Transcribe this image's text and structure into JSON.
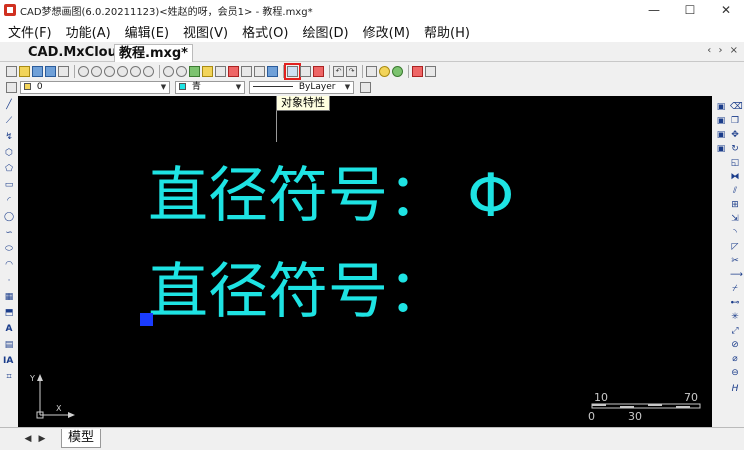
{
  "window": {
    "title": "CAD梦想画图(6.0.20211123)<姓赵的呀，会员1> - 教程.mxg*",
    "minimize_label": "—",
    "maximize_label": "☐",
    "close_label": "✕"
  },
  "menu": {
    "items": [
      {
        "label": "文件(F)"
      },
      {
        "label": "功能(A)"
      },
      {
        "label": "编辑(E)"
      },
      {
        "label": "视图(V)"
      },
      {
        "label": "格式(O)"
      },
      {
        "label": "绘图(D)"
      },
      {
        "label": "修改(M)"
      },
      {
        "label": "帮助(H)"
      }
    ]
  },
  "tabs": {
    "items": [
      {
        "label": "CAD.MxCloud"
      },
      {
        "label": "教程.mxg*"
      }
    ],
    "arrows": "‹ › ×"
  },
  "layer_bar": {
    "layer_value": "0",
    "color_value": "青",
    "linetype_value": "ByLayer"
  },
  "tooltip": {
    "text": "对象特性"
  },
  "canvas": {
    "background": "#000000",
    "text_color": "#1ee3e3",
    "text_line1": "直径符号：  Φ",
    "text_line2": "直径符号：",
    "ucs_y": "Y",
    "ucs_x": "X",
    "scale_labels": {
      "a": "10",
      "b": "70",
      "c": "0",
      "d": "30"
    }
  },
  "layout_tabs": {
    "model_label": "模型"
  },
  "colors": {
    "accent_highlight": "#e02020",
    "grip": "#1a3cff"
  }
}
